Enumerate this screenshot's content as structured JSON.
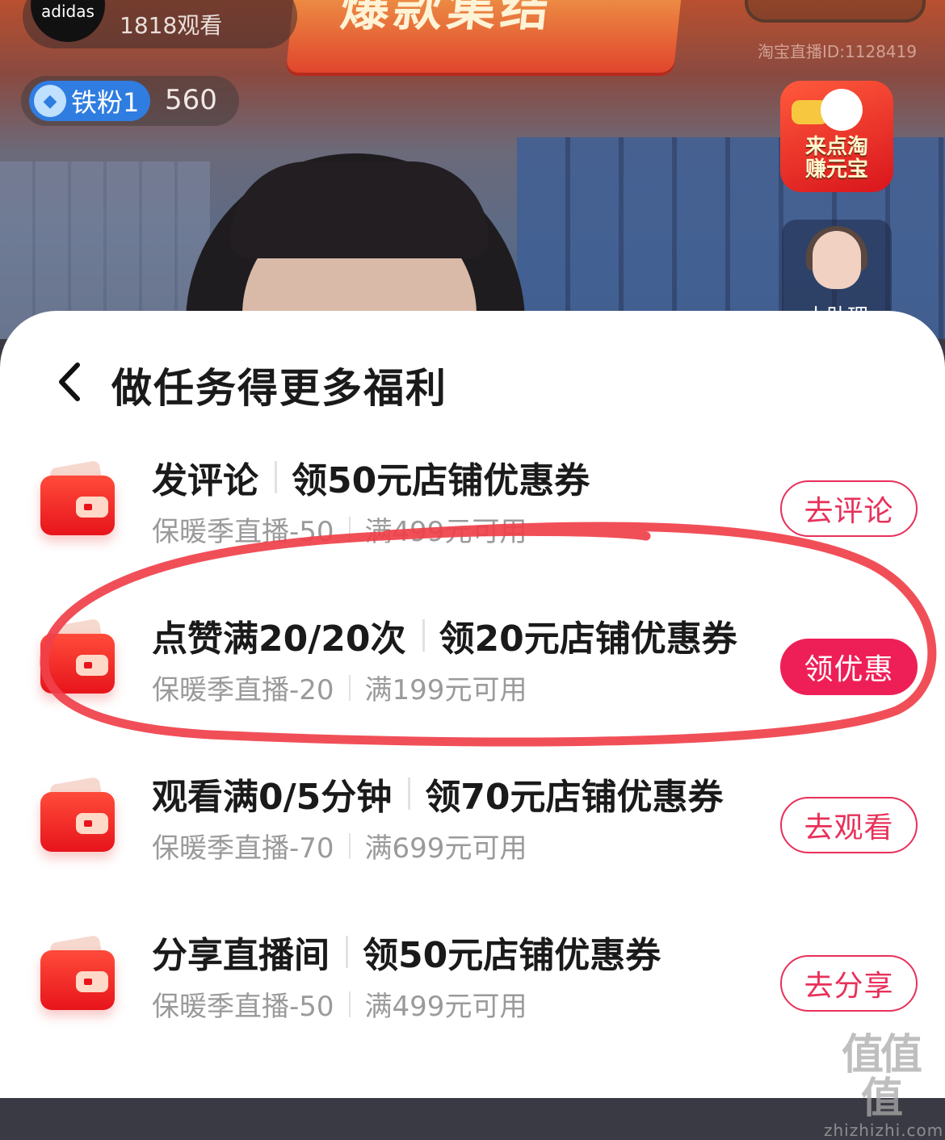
{
  "stream": {
    "host_logo_text": "adidas",
    "viewer_count": "1818观看",
    "banner_text": "爆款集结",
    "stream_id": "淘宝直播ID:1128419",
    "fan_level_label": "铁粉1",
    "fan_points": "560",
    "promo_line1": "来点淘",
    "promo_line2": "赚元宝",
    "assistant_label": "小助理"
  },
  "sheet": {
    "title": "做任务得更多福利",
    "tasks": [
      {
        "name": "发评论",
        "reward": "领50元店铺优惠券",
        "coupon": "保暖季直播-50",
        "condition": "满499元可用",
        "button": "去评论",
        "primary": false
      },
      {
        "name": "点赞满20/20次",
        "reward": "领20元店铺优惠券",
        "coupon": "保暖季直播-20",
        "condition": "满199元可用",
        "button": "领优惠",
        "primary": true
      },
      {
        "name": "观看满0/5分钟",
        "reward": "领70元店铺优惠券",
        "coupon": "保暖季直播-70",
        "condition": "满699元可用",
        "button": "去观看",
        "primary": false
      },
      {
        "name": "分享直播间",
        "reward": "领50元店铺优惠券",
        "coupon": "保暖季直播-50",
        "condition": "满499元可用",
        "button": "去分享",
        "primary": false
      }
    ]
  },
  "watermark": {
    "glyphs": "值值值",
    "url": "zhizhizhi.com"
  },
  "colors": {
    "accent": "#ee1f57",
    "annotation_circle": "#f0404a",
    "wallet_red": "#e7141b"
  }
}
